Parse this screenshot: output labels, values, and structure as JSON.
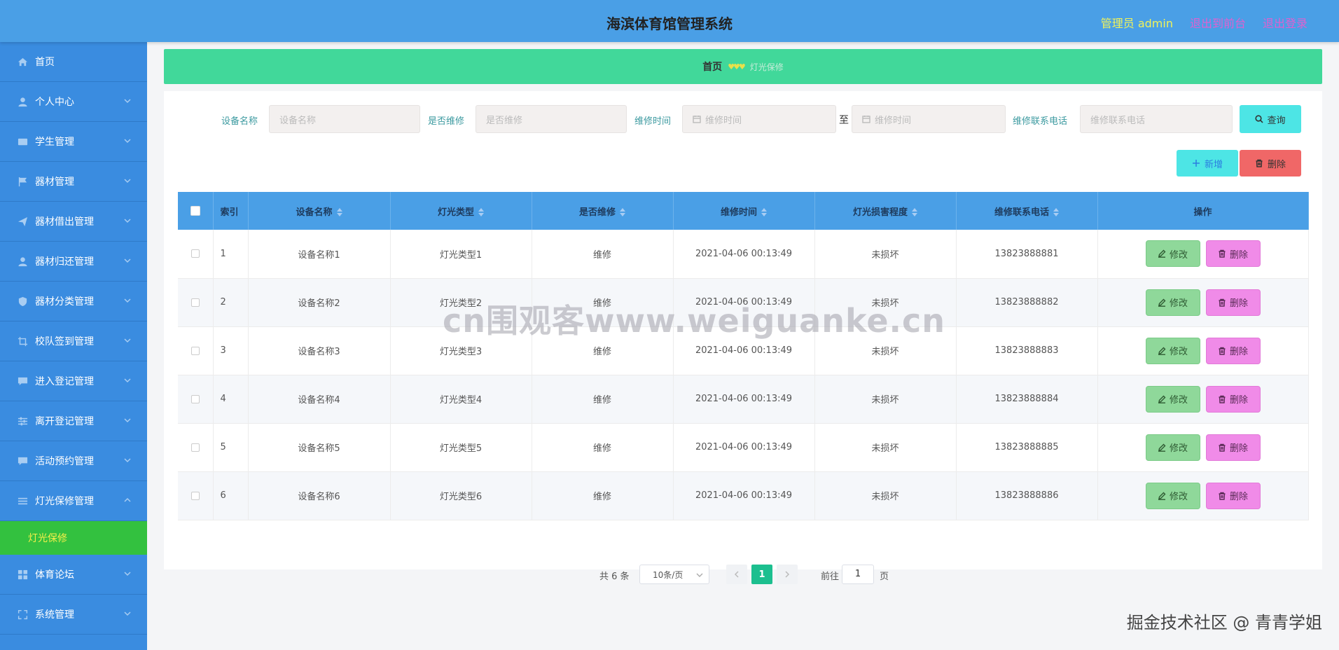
{
  "header": {
    "title": "海滨体育馆管理系统",
    "admin": "管理员 admin",
    "back_to_front": "退出到前台",
    "logout": "退出登录"
  },
  "sidebar": {
    "items": [
      {
        "label": "首页",
        "icon": "home-icon"
      },
      {
        "label": "个人中心",
        "icon": "user-icon"
      },
      {
        "label": "学生管理",
        "icon": "picture-icon"
      },
      {
        "label": "器材管理",
        "icon": "flag-icon"
      },
      {
        "label": "器材借出管理",
        "icon": "send-icon"
      },
      {
        "label": "器材归还管理",
        "icon": "person-icon"
      },
      {
        "label": "器材分类管理",
        "icon": "shield-icon"
      },
      {
        "label": "校队签到管理",
        "icon": "crop-icon"
      },
      {
        "label": "进入登记管理",
        "icon": "chat-icon"
      },
      {
        "label": "离开登记管理",
        "icon": "sliders-icon"
      },
      {
        "label": "活动预约管理",
        "icon": "message-icon"
      },
      {
        "label": "灯光保修管理",
        "icon": "menu-icon"
      },
      {
        "label": "体育论坛",
        "icon": "grid-icon"
      },
      {
        "label": "系统管理",
        "icon": "fullscreen-icon"
      }
    ],
    "sub_item": "灯光保修"
  },
  "breadcrumb": {
    "home": "首页",
    "separator": "♥♥♥",
    "current": "灯光保修"
  },
  "search": {
    "device_name_label": "设备名称",
    "device_name_placeholder": "设备名称",
    "repair_label": "是否维修",
    "repair_placeholder": "是否维修",
    "time_label": "维修时间",
    "time_start_placeholder": "维修时间",
    "to": "至",
    "time_end_placeholder": "维修时间",
    "phone_label": "维修联系电话",
    "phone_placeholder": "维修联系电话",
    "query_button": "查询"
  },
  "actions": {
    "add": "新增",
    "delete": "删除"
  },
  "table": {
    "columns": [
      "索引",
      "设备名称",
      "灯光类型",
      "是否维修",
      "维修时间",
      "灯光损害程度",
      "维修联系电话",
      "操作"
    ],
    "rows": [
      {
        "index": "1",
        "name": "设备名称1",
        "type": "灯光类型1",
        "repair": "维修",
        "time": "2021-04-06 00:13:49",
        "damage": "未损坏",
        "phone": "13823888881"
      },
      {
        "index": "2",
        "name": "设备名称2",
        "type": "灯光类型2",
        "repair": "维修",
        "time": "2021-04-06 00:13:49",
        "damage": "未损坏",
        "phone": "13823888882"
      },
      {
        "index": "3",
        "name": "设备名称3",
        "type": "灯光类型3",
        "repair": "维修",
        "time": "2021-04-06 00:13:49",
        "damage": "未损坏",
        "phone": "13823888883"
      },
      {
        "index": "4",
        "name": "设备名称4",
        "type": "灯光类型4",
        "repair": "维修",
        "time": "2021-04-06 00:13:49",
        "damage": "未损坏",
        "phone": "13823888884"
      },
      {
        "index": "5",
        "name": "设备名称5",
        "type": "灯光类型5",
        "repair": "维修",
        "time": "2021-04-06 00:13:49",
        "damage": "未损坏",
        "phone": "13823888885"
      },
      {
        "index": "6",
        "name": "设备名称6",
        "type": "灯光类型6",
        "repair": "维修",
        "time": "2021-04-06 00:13:49",
        "damage": "未损坏",
        "phone": "13823888886"
      }
    ],
    "edit_label": "修改",
    "delete_label": "删除"
  },
  "pagination": {
    "total": "共 6 条",
    "page_size": "10条/页",
    "current_page": "1",
    "goto_label": "前往",
    "goto_value": "1",
    "page_suffix": "页"
  },
  "watermark": "cn围观客www.weiguanke.cn",
  "footer_mark": "掘金技术社区 @ 青青学姐",
  "colors": {
    "header_bg": "#4a9fe6",
    "sidebar_bg": "#3a8ce0",
    "active_sub_bg": "#33c13f",
    "breadcrumb_bg": "#41d89a",
    "edit_btn": "#8fd89a",
    "delete_btn": "#f08be8"
  }
}
